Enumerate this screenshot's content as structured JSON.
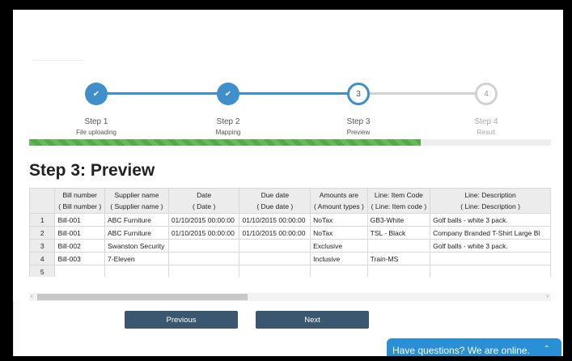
{
  "stepper": {
    "steps": [
      {
        "number": "1",
        "title": "Step 1",
        "subtitle": "File uploading",
        "state": "done"
      },
      {
        "number": "2",
        "title": "Step 2",
        "subtitle": "Mapping",
        "state": "done"
      },
      {
        "number": "3",
        "title": "Step 3",
        "subtitle": "Preview",
        "state": "current"
      },
      {
        "number": "4",
        "title": "Step 4",
        "subtitle": "Result",
        "state": "todo"
      }
    ],
    "check_glyph": "✔",
    "progress_fraction": 0.75
  },
  "page": {
    "heading": "Step 3: Preview"
  },
  "table": {
    "columns": [
      {
        "name": "Bill number",
        "mapped": "( Bill number )"
      },
      {
        "name": "Supplier name",
        "mapped": "( Supplier name )"
      },
      {
        "name": "Date",
        "mapped": "( Date )"
      },
      {
        "name": "Due date",
        "mapped": "( Due date )"
      },
      {
        "name": "Amounts are",
        "mapped": "( Amount types )"
      },
      {
        "name": "Line: Item Code",
        "mapped": "( Line: Item code )"
      },
      {
        "name": "Line: Description",
        "mapped": "( Line: Description )"
      }
    ],
    "rows": [
      {
        "num": "1",
        "cells": [
          "Bill-001",
          "ABC Furniture",
          "01/10/2015 00:00:00",
          "01/10/2015 00:00:00",
          "NoTax",
          "GB3-White",
          "Golf balls - white 3 pack."
        ]
      },
      {
        "num": "2",
        "cells": [
          "Bill-001",
          "ABC Furniture",
          "01/10/2015 00:00:00",
          "01/10/2015 00:00:00",
          "NoTax",
          "TSL - Black",
          "Company Branded T-Shirt Large Bl"
        ]
      },
      {
        "num": "3",
        "cells": [
          "Bill-002",
          "Swanston Security",
          "",
          "",
          "Exclusive",
          "",
          "Golf balls - white 3 pack."
        ]
      },
      {
        "num": "4",
        "cells": [
          "Bill-003",
          "7-Eleven",
          "",
          "",
          "Inclusive",
          "Train-MS",
          ""
        ]
      },
      {
        "num": "5",
        "cells": [
          "",
          "",
          "",
          "",
          "",
          "",
          ""
        ]
      }
    ]
  },
  "scrollbar": {
    "left_arrow": "‹",
    "right_arrow": "›"
  },
  "buttons": {
    "previous": "Previous",
    "next": "Next"
  },
  "chat": {
    "label": "Have questions? We are online.",
    "caret": "⌃"
  },
  "colors": {
    "accent": "#3f8fcd",
    "button": "#3b5770",
    "progress": "#5fb052",
    "chat": "#2a8fd4"
  }
}
